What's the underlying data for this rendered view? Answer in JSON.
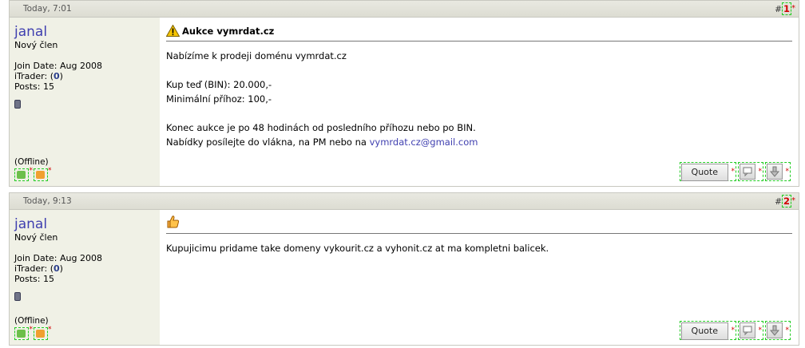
{
  "posts": [
    {
      "date": "Today, 7:01",
      "number": "1",
      "number_prefix": "#",
      "user": {
        "name": "janal",
        "title": "Nový člen",
        "join_date": "Join Date: Aug 2008",
        "itrader_label": "iTrader: (",
        "itrader_value": "0",
        "itrader_close": ")",
        "posts": "Posts: 15",
        "status": "(Offline)"
      },
      "title": "Aukce vymrdat.cz",
      "body_lines": [
        "Nabízíme k prodeji doménu vymrdat.cz",
        "Kup teď (BIN): 20.000,-",
        "Minimální příhoz: 100,-",
        "Konec aukce je po 48 hodinách od posledního příhozu nebo po BIN.",
        "Nabídky posílejte do vlákna, na PM nebo na "
      ],
      "email": "vymrdat.cz@gmail.com",
      "quote_label": "Quote"
    },
    {
      "date": "Today, 9:13",
      "number": "2",
      "number_prefix": "#",
      "user": {
        "name": "janal",
        "title": "Nový člen",
        "join_date": "Join Date: Aug 2008",
        "itrader_label": "iTrader: (",
        "itrader_value": "0",
        "itrader_close": ")",
        "posts": "Posts: 15",
        "status": "(Offline)"
      },
      "body_lines": [
        "Kupujicimu pridame take domeny vykourit.cz a vyhonit.cz at ma kompletni balicek."
      ],
      "quote_label": "Quote"
    }
  ],
  "markers": {
    "star": "*"
  },
  "icons": {
    "warning": "warning-icon",
    "thumbs_up": "thumbs-up-icon",
    "multiquote": "multiquote-icon",
    "report": "report-icon",
    "status_online": "user-status-icon",
    "send_pm": "send-pm-icon"
  },
  "colors": {
    "username": "#4040b0",
    "sidebar_bg": "#f0f1e6",
    "header_bg": "#dcdcd2",
    "edit_marker": "#d00000",
    "dashed_outline": "#22cc22"
  }
}
